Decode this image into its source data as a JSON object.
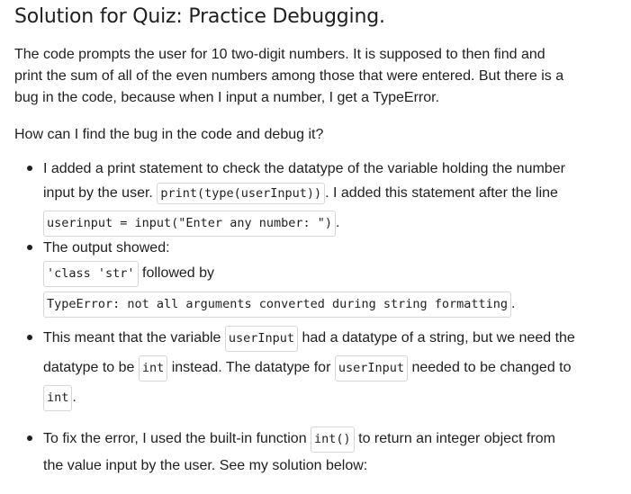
{
  "title": "Solution for Quiz: Practice Debugging.",
  "intro": {
    "line1": "The code prompts the user for 10 two-digit numbers. It is supposed to then find and",
    "line2": "print the sum of all of the even numbers among those that were entered. But there is a",
    "line3": "bug in the code, because when I input a number, I get a TypeError."
  },
  "question": "How can I find the bug in the code and debug it?",
  "bullet1": {
    "line1": "I added a print statement to check the datatype of the variable holding the number",
    "pre": "input by the user. ",
    "code1": "print(type(userInput))",
    "mid": ". I added this statement after the line",
    "code2": "userinput = input(\"Enter any number: \")",
    "end": "."
  },
  "bullet2": {
    "line1": "The output showed:",
    "code1": "'class 'str'",
    "mid": " followed by",
    "code2": "TypeError: not all arguments converted during string formatting",
    "end": "."
  },
  "bullet3": {
    "pre": "This meant that the variable ",
    "code1": "userInput",
    "mid1": " had a datatype of a string, but we need the",
    "pre2": "datatype to be ",
    "code2": "int",
    "mid2": " instead. The datatype for ",
    "code3": "userInput",
    "mid3": " needed to be changed to",
    "code4": "int",
    "end": "."
  },
  "bullet4": {
    "pre": "To fix the error, I used the built-in function ",
    "code1": "int()",
    "mid": " to return an integer object from",
    "line2": "the value input by the user. See my solution below:"
  }
}
